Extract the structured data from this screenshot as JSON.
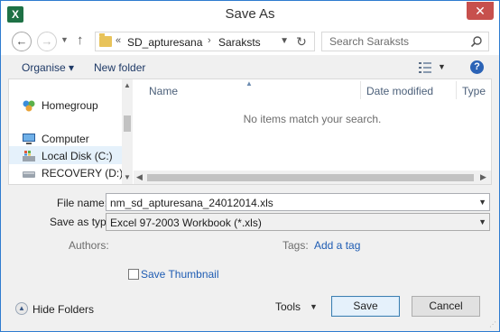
{
  "window": {
    "title": "Save As",
    "app_icon_letter": "X",
    "close_glyph": "✕"
  },
  "nav": {
    "back_glyph": "←",
    "forward_glyph": "→",
    "recent_glyph": "▼",
    "up_glyph": "↑",
    "breadcrumb_overflow": "«",
    "breadcrumbs": [
      "SD_apturesana",
      "Saraksts"
    ],
    "crumb_separator": "›",
    "refresh_glyph": "↻",
    "search_placeholder": "Search Saraksts"
  },
  "toolbar": {
    "organise_label": "Organise ▾",
    "new_folder_label": "New folder",
    "view_drop": "▼",
    "help_glyph": "?"
  },
  "sidebar": {
    "items": [
      {
        "label": "Homegroup"
      },
      {
        "label": "Computer"
      },
      {
        "label": "Local Disk (C:)"
      },
      {
        "label": "RECOVERY (D:)"
      }
    ],
    "scroll_up": "▲",
    "scroll_down": "▼"
  },
  "files": {
    "columns": [
      "Name",
      "Date modified",
      "Type"
    ],
    "sort_glyph": "▲",
    "empty_message": "No items match your search.",
    "scroll_left": "◀",
    "scroll_right": "▶"
  },
  "form": {
    "file_name_label": "File name:",
    "file_name_value": "nm_sd_apturesana_24012014.xls",
    "save_type_label": "Save as type:",
    "save_type_value": "Excel 97-2003 Workbook (*.xls)",
    "combo_arrow": "▼",
    "authors_label": "Authors:",
    "tags_label": "Tags:",
    "add_tag_link": "Add a tag",
    "save_thumbnail_label": "Save Thumbnail"
  },
  "footer": {
    "hide_folders_label": "Hide Folders",
    "hide_folders_glyph": "▲",
    "tools_label": "Tools",
    "tools_drop": "▼",
    "save_label": "Save",
    "cancel_label": "Cancel"
  },
  "colors": {
    "accent": "#2e7bcf",
    "excel_green": "#1e7145",
    "link": "#1e5cb3",
    "close_red": "#c7504d"
  }
}
